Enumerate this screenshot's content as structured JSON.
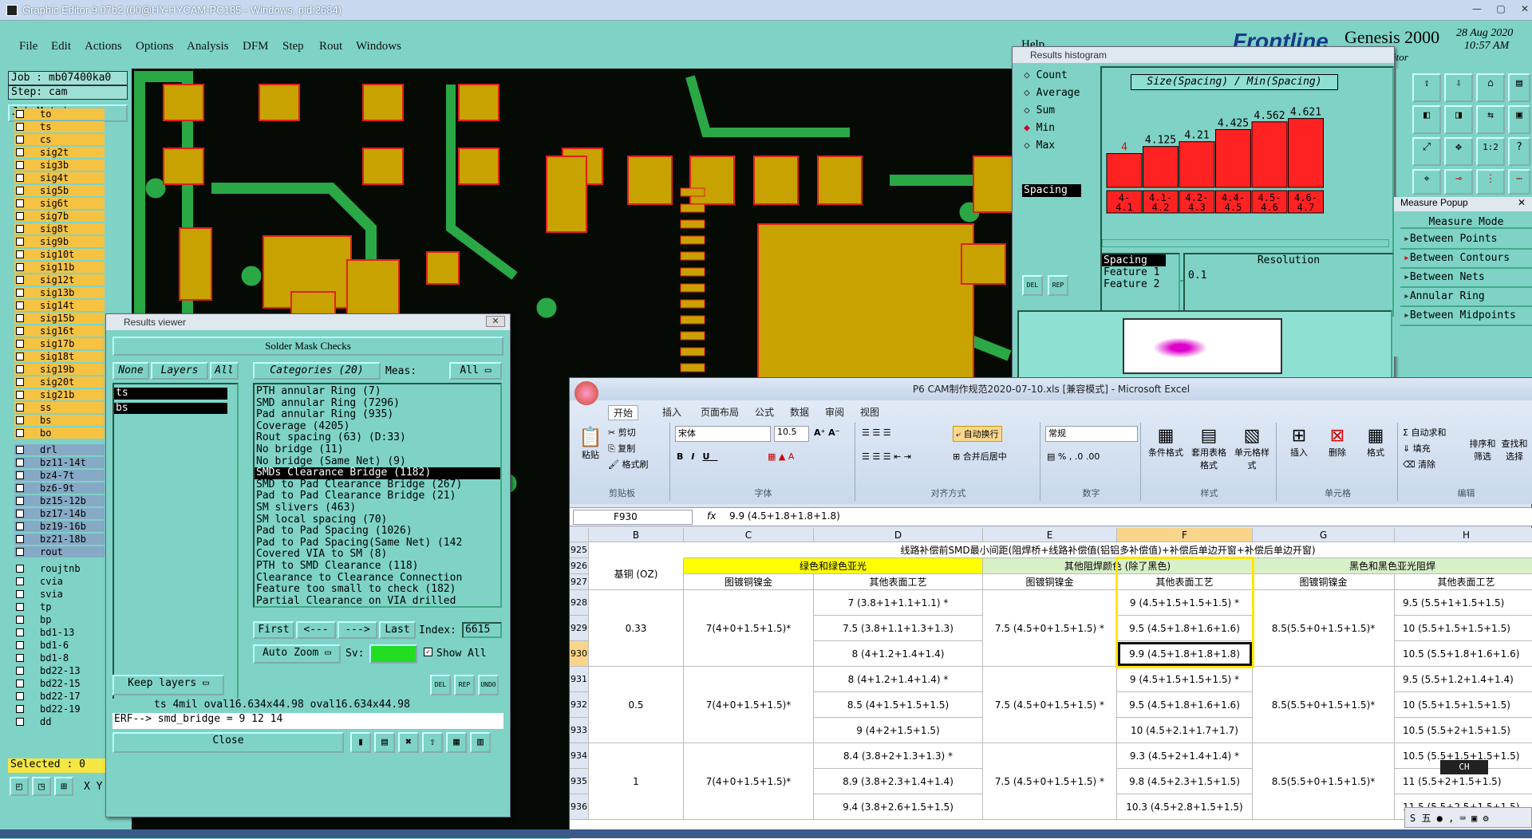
{
  "titlebar": {
    "title": "Graphic Editor 9.07b2 (00@HY-HYCAM-PC185 - Windows, pid:2684)"
  },
  "menu": [
    "File",
    "Edit",
    "Actions",
    "Options",
    "Analysis",
    "DFM",
    "Step",
    "Rout",
    "Windows"
  ],
  "header_right": {
    "brand": "Frontline",
    "product": "Genesis 2000",
    "date": "28 Aug 2020",
    "time": "10:57 AM",
    "sub": "Graphic Editor",
    "help": "Help"
  },
  "job": {
    "job_label": "Job : mb07400ka0",
    "step_label": "Step: cam",
    "matrix_button": "Job Matrix ..."
  },
  "layers": [
    {
      "name": "to",
      "color": "yellow"
    },
    {
      "name": "ts",
      "color": "yellow"
    },
    {
      "name": "cs",
      "color": "yellow"
    },
    {
      "name": "sig2t",
      "color": "yellow"
    },
    {
      "name": "sig3b",
      "color": "yellow"
    },
    {
      "name": "sig4t",
      "color": "yellow"
    },
    {
      "name": "sig5b",
      "color": "yellow"
    },
    {
      "name": "sig6t",
      "color": "yellow"
    },
    {
      "name": "sig7b",
      "color": "yellow"
    },
    {
      "name": "sig8t",
      "color": "yellow"
    },
    {
      "name": "sig9b",
      "color": "yellow"
    },
    {
      "name": "sig10t",
      "color": "yellow"
    },
    {
      "name": "sig11b",
      "color": "yellow"
    },
    {
      "name": "sig12t",
      "color": "yellow"
    },
    {
      "name": "sig13b",
      "color": "yellow"
    },
    {
      "name": "sig14t",
      "color": "yellow"
    },
    {
      "name": "sig15b",
      "color": "yellow"
    },
    {
      "name": "sig16t",
      "color": "yellow"
    },
    {
      "name": "sig17b",
      "color": "yellow"
    },
    {
      "name": "sig18t",
      "color": "yellow"
    },
    {
      "name": "sig19b",
      "color": "yellow"
    },
    {
      "name": "sig20t",
      "color": "yellow"
    },
    {
      "name": "sig21b",
      "color": "yellow"
    },
    {
      "name": "ss",
      "color": "yellow"
    },
    {
      "name": "bs",
      "color": "yellow"
    },
    {
      "name": "bo",
      "color": "yellow"
    },
    {
      "name": "drl",
      "color": "blue"
    },
    {
      "name": "bz11-14t",
      "color": "blue"
    },
    {
      "name": "bz4-7t",
      "color": "blue"
    },
    {
      "name": "bz6-9t",
      "color": "blue"
    },
    {
      "name": "bz15-12b",
      "color": "blue"
    },
    {
      "name": "bz17-14b",
      "color": "blue"
    },
    {
      "name": "bz19-16b",
      "color": "blue"
    },
    {
      "name": "bz21-18b",
      "color": "blue"
    },
    {
      "name": "rout",
      "color": "blue"
    },
    {
      "name": "roujtnb",
      "color": "teal"
    },
    {
      "name": "cvia",
      "color": "teal"
    },
    {
      "name": "svia",
      "color": "teal"
    },
    {
      "name": "tp",
      "color": "teal"
    },
    {
      "name": "bp",
      "color": "teal"
    },
    {
      "name": "bd1-13",
      "color": "teal"
    },
    {
      "name": "bd1-6",
      "color": "teal"
    },
    {
      "name": "bd1-8",
      "color": "teal"
    },
    {
      "name": "bd22-13",
      "color": "teal"
    },
    {
      "name": "bd22-15",
      "color": "teal"
    },
    {
      "name": "bd22-17",
      "color": "teal"
    },
    {
      "name": "bd22-19",
      "color": "teal"
    },
    {
      "name": "dd",
      "color": "teal"
    }
  ],
  "selected": "Selected : 0",
  "results_viewer": {
    "title": "Results viewer",
    "heading": "Solder Mask Checks",
    "none_btn": "None",
    "layers_btn": "Layers",
    "all_btn": "All",
    "categories_label": "Categories (20)",
    "meas_label": "Meas:",
    "meas_value": "All",
    "layer_list": [
      "ts",
      "bs"
    ],
    "categories": [
      "PTH annular Ring (7)",
      "SMD annular Ring (7296)",
      "Pad annular Ring (935)",
      "Coverage (4205)",
      "Rout spacing (63)          (D:33)",
      "No bridge (11)",
      "No bridge (Same Net) (9)",
      "SMDs Clearance Bridge (1182)",
      "SMD to Pad Clearance Bridge (267)",
      "Pad to Pad Clearance Bridge (21)",
      "SM slivers (463)",
      "SM local spacing (70)",
      "Pad to Pad Spacing (1026)",
      "Pad to Pad Spacing(Same Net) (142",
      "Covered VIA to SM (8)",
      "PTH to SMD Clearance (118)",
      "Clearance to Clearance Connection",
      "Feature too small to check (182)",
      "Partial Clearance on VIA drilled"
    ],
    "selected_category": 7,
    "first": "First",
    "prev": "<---",
    "next": "--->",
    "last": "Last",
    "index_label": "Index:",
    "index_value": "6615",
    "auto_zoom": "Auto Zoom",
    "sv_label": "Sv:",
    "show_all": "Show All",
    "keep_layers": "Keep layers",
    "info_line": "ts 4mil   oval16.634x44.98   oval16.634x44.98",
    "erf_line": "ERF--> smd_bridge = 9 12 14",
    "close": "Close"
  },
  "histogram": {
    "title": "Results histogram",
    "options": [
      "Count",
      "Average",
      "Sum",
      "Min",
      "Max"
    ],
    "selected_option": "Min",
    "chart_title": "Size(Spacing) / Min(Spacing)",
    "list_item": "Spacing",
    "feature1": "Feature 1",
    "feature2": "Feature 2",
    "spacing": "Spacing",
    "resolution_label": "Resolution",
    "resolution_value": "0.1",
    "del": "DEL",
    "rep": "REP"
  },
  "chart_data": {
    "type": "bar",
    "title": "Size(Spacing) / Min(Spacing)",
    "categories": [
      "4-4.1",
      "4.1-4.2",
      "4.2-4.3",
      "4.4-4.5",
      "4.5-4.6",
      "4.6-4.7"
    ],
    "values": [
      4,
      4.125,
      4.21,
      4.425,
      4.562,
      4.621
    ],
    "labels": [
      "4",
      "4.125",
      "4.21",
      "4.425",
      "4.562",
      "4.621"
    ]
  },
  "measure_popup": {
    "title": "Measure Popup",
    "heading": "Measure Mode",
    "items": [
      "Between Points",
      "Between Contours",
      "Between Nets",
      "Annular Ring",
      "Between Midpoints"
    ]
  },
  "excel": {
    "title": "P6 CAM制作规范2020-07-10.xls  [兼容模式] - Microsoft Excel",
    "tabs": [
      "开始",
      "插入",
      "页面布局",
      "公式",
      "数据",
      "审阅",
      "视图"
    ],
    "clipboard": {
      "paste": "粘贴",
      "cut": "剪切",
      "copy": "复制",
      "format": "格式刷",
      "label": "剪贴板"
    },
    "font": {
      "name": "宋体",
      "size": "10.5",
      "label": "字体"
    },
    "align": {
      "wrap": "自动换行",
      "merge": "合并后居中",
      "label": "对齐方式"
    },
    "number": {
      "format": "常规",
      "label": "数字"
    },
    "styles": {
      "cond": "条件格式",
      "table": "套用表格格式",
      "cell": "单元格样式",
      "label": "样式"
    },
    "cells": {
      "insert": "插入",
      "delete": "删除",
      "format": "格式",
      "label": "单元格"
    },
    "edit": {
      "sum": "自动求和",
      "fill": "填充",
      "clear": "清除",
      "sort": "排序和筛选",
      "find": "查找和选择",
      "label": "编辑"
    },
    "namebox": "F930",
    "formula": "9.9 (4.5+1.8+1.8+1.8)",
    "cols": [
      "B",
      "C",
      "D",
      "E",
      "F",
      "G",
      "H"
    ],
    "rows": [
      "925",
      "926",
      "927",
      "928",
      "929",
      "930",
      "931",
      "932",
      "933",
      "934",
      "935",
      "936"
    ],
    "r925": "线路补偿前SMD最小间距(阻焊桥+线路补偿值(铝铝多补偿值)+补偿后单边开窗+补偿后单边开窗)",
    "base_copper": "基铜 (OZ)",
    "green": "绿色和绿色亚光",
    "other": "其他阻焊颜色 (除了黑色)",
    "black": "黑色和黑色亚光阻焊",
    "tin": "图镀铜镍金",
    "other_surf": "其他表面工艺",
    "b1": "0.33",
    "b2": "0.5",
    "b3": "1",
    "c1": "7(4+0+1.5+1.5)*",
    "c2": "7(4+0+1.5+1.5)*",
    "c3": "7(4+0+1.5+1.5)*",
    "d": [
      "7 (3.8+1+1.1+1.1) *",
      "7.5 (3.8+1.1+1.3+1.3)",
      "8 (4+1.2+1.4+1.4)",
      "8 (4+1.2+1.4+1.4) *",
      "8.5 (4+1.5+1.5+1.5)",
      "9 (4+2+1.5+1.5)",
      "8.4 (3.8+2+1.3+1.3) *",
      "8.9 (3.8+2.3+1.4+1.4)",
      "9.4 (3.8+2.6+1.5+1.5)"
    ],
    "e1": "7.5 (4.5+0+1.5+1.5) *",
    "e2": "7.5 (4.5+0+1.5+1.5) *",
    "e3": "7.5 (4.5+0+1.5+1.5) *",
    "f": [
      "9 (4.5+1.5+1.5+1.5) *",
      "9.5 (4.5+1.8+1.6+1.6)",
      "9.9 (4.5+1.8+1.8+1.8)",
      "9 (4.5+1.5+1.5+1.5) *",
      "9.5 (4.5+1.8+1.6+1.6)",
      "10 (4.5+2.1+1.7+1.7)",
      "9.3 (4.5+2+1.4+1.4) *",
      "9.8 (4.5+2.3+1.5+1.5)",
      "10.3 (4.5+2.8+1.5+1.5)"
    ],
    "g1": "8.5(5.5+0+1.5+1.5)*",
    "g2": "8.5(5.5+0+1.5+1.5)*",
    "g3": "8.5(5.5+0+1.5+1.5)*",
    "h": [
      "9.5 (5.5+1+1.5+1.5)",
      "10 (5.5+1.5+1.5+1.5)",
      "10.5 (5.5+1.8+1.6+1.6)",
      "9.5 (5.5+1.2+1.4+1.4)",
      "10 (5.5+1.5+1.5+1.5)",
      "10.5 (5.5+2+1.5+1.5)",
      "10.5 (5.5+1.5+1.5+1.5)",
      "11 (5.5+2+1.5+1.5)",
      "11.5 (5.5+2.5+1.5+1.5)"
    ]
  },
  "ime": {
    "ch": "CH"
  }
}
